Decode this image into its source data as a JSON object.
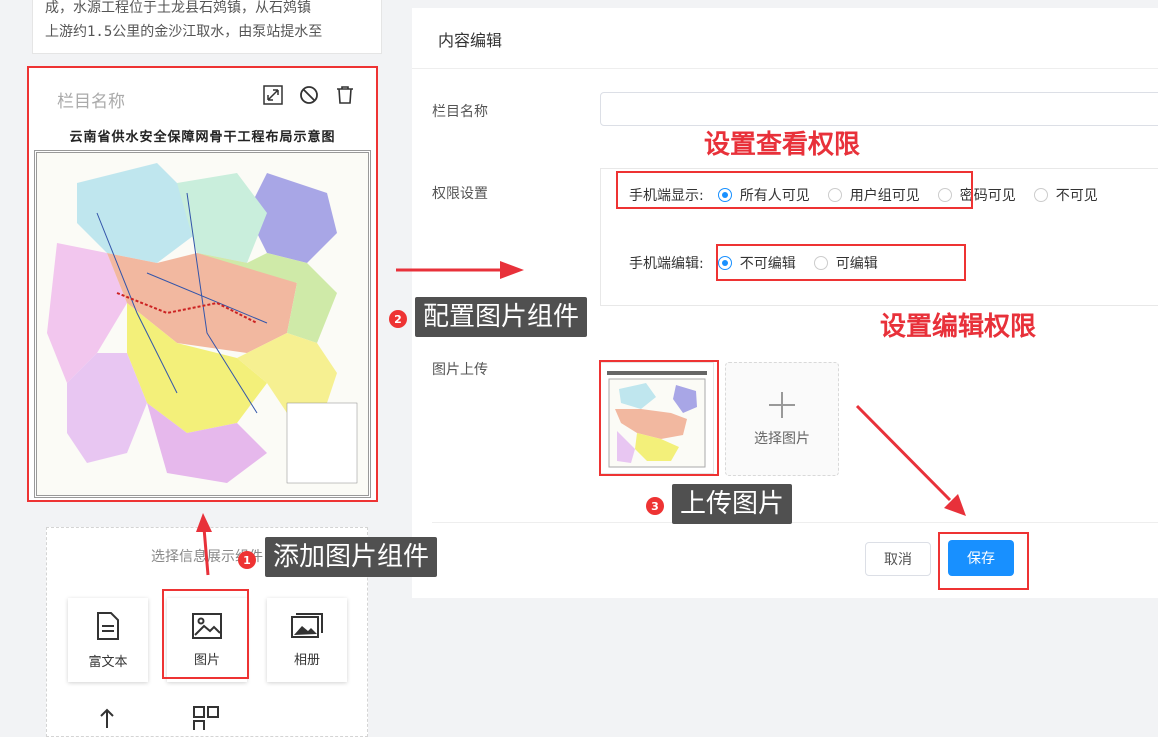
{
  "preview": {
    "text_line_1": "成，水源工程位于土龙县石䴔镇，从石䴔镇",
    "text_line_2": "上游约1.5公里的金沙江取水，由泵站提水至",
    "image_card_title": "栏目名称",
    "map_title": "云南省供水安全保障网骨干工程布局示意图",
    "tools": [
      "shrink-icon",
      "disable-icon",
      "trash-icon"
    ]
  },
  "picker": {
    "title": "选择信息展示组件",
    "tiles": [
      {
        "label": "富文本",
        "icon": "document-icon"
      },
      {
        "label": "图片",
        "icon": "image-icon"
      },
      {
        "label": "相册",
        "icon": "album-icon"
      }
    ]
  },
  "editor": {
    "title": "内容编辑",
    "name_label": "栏目名称",
    "name_value": "",
    "perm_label": "权限设置",
    "mobile_display_label": "手机端显示:",
    "display_options": [
      {
        "label": "所有人可见",
        "selected": true
      },
      {
        "label": "用户组可见",
        "selected": false
      },
      {
        "label": "密码可见",
        "selected": false
      },
      {
        "label": "不可见",
        "selected": false
      }
    ],
    "mobile_edit_label": "手机端编辑:",
    "edit_options": [
      {
        "label": "不可编辑",
        "selected": true
      },
      {
        "label": "可编辑",
        "selected": false
      }
    ],
    "upload_label": "图片上传",
    "choose_image": "选择图片",
    "cancel": "取消",
    "save": "保存"
  },
  "annotations": {
    "view_permission": "设置查看权限",
    "edit_permission": "设置编辑权限",
    "step1": {
      "num": "1",
      "text": "添加图片组件"
    },
    "step2": {
      "num": "2",
      "text": "配置图片组件"
    },
    "step3": {
      "num": "3",
      "text": "上传图片"
    }
  },
  "colors": {
    "accent": "#1890ff",
    "annotation_red": "#e8313a"
  }
}
